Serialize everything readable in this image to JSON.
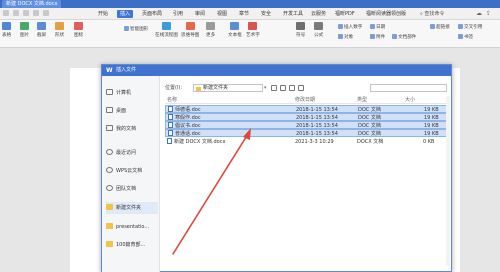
{
  "titlebar": {
    "doc_tab": "新建 DOCX 文档.docx"
  },
  "menubar": {
    "items": [
      "开始",
      "插入",
      "页面布局",
      "引用",
      "审阅",
      "视图",
      "章节",
      "安全",
      "开发工具",
      "云服务",
      "福昕PDF",
      "福昕阅读器领创版"
    ],
    "active_index": 1,
    "search_placeholder": "查找命令"
  },
  "ribbon": {
    "buttons": [
      "表格",
      "图片",
      "截屏",
      "形状",
      "图标",
      "在线流程图",
      "思维导图",
      "更多",
      "文本框",
      "艺术字",
      "符号",
      "公式"
    ],
    "small_items": [
      "智能图形",
      "插入数字",
      "对象",
      "日期",
      "附件",
      "文档部件",
      "超链接",
      "交叉引用",
      "书签"
    ]
  },
  "dialog": {
    "title": "插入文件",
    "logo": "W",
    "location_label": "位置(I):",
    "location_value": "新建文件夹",
    "sidebar": [
      "计算机",
      "桌面",
      "我的文档",
      "最近访问",
      "WPS云文档",
      "团队文档",
      "新建文件夹",
      "presentatio...",
      "100篇育部..."
    ],
    "sidebar_selected": 6,
    "columns": {
      "name": "名称",
      "date": "修改日期",
      "type": "类型",
      "size": "大小"
    },
    "files": [
      {
        "name": "师德语.doc",
        "date": "2018-1-15 13:54",
        "type": "DOC 文档",
        "size": "19 KB",
        "selected": true
      },
      {
        "name": "寒假作.doc",
        "date": "2018-1-15 13:54",
        "type": "DOC 文档",
        "size": "19 KB",
        "selected": true
      },
      {
        "name": "倡议书.doc",
        "date": "2018-1-15 13:54",
        "type": "DOC 文档",
        "size": "19 KB",
        "selected": true
      },
      {
        "name": "普通话.doc",
        "date": "2018-1-15 13:54",
        "type": "DOC 文档",
        "size": "19 KB",
        "selected": true
      },
      {
        "name": "新建 DOCX 文档.docx",
        "date": "2021-3-3 10:29",
        "type": "DOCX 文档",
        "size": "0 KB",
        "selected": false
      }
    ]
  },
  "colors": {
    "title_blue": "#3d6fc6",
    "selection": "#cfe0f7",
    "arrow": "#e0443a"
  }
}
